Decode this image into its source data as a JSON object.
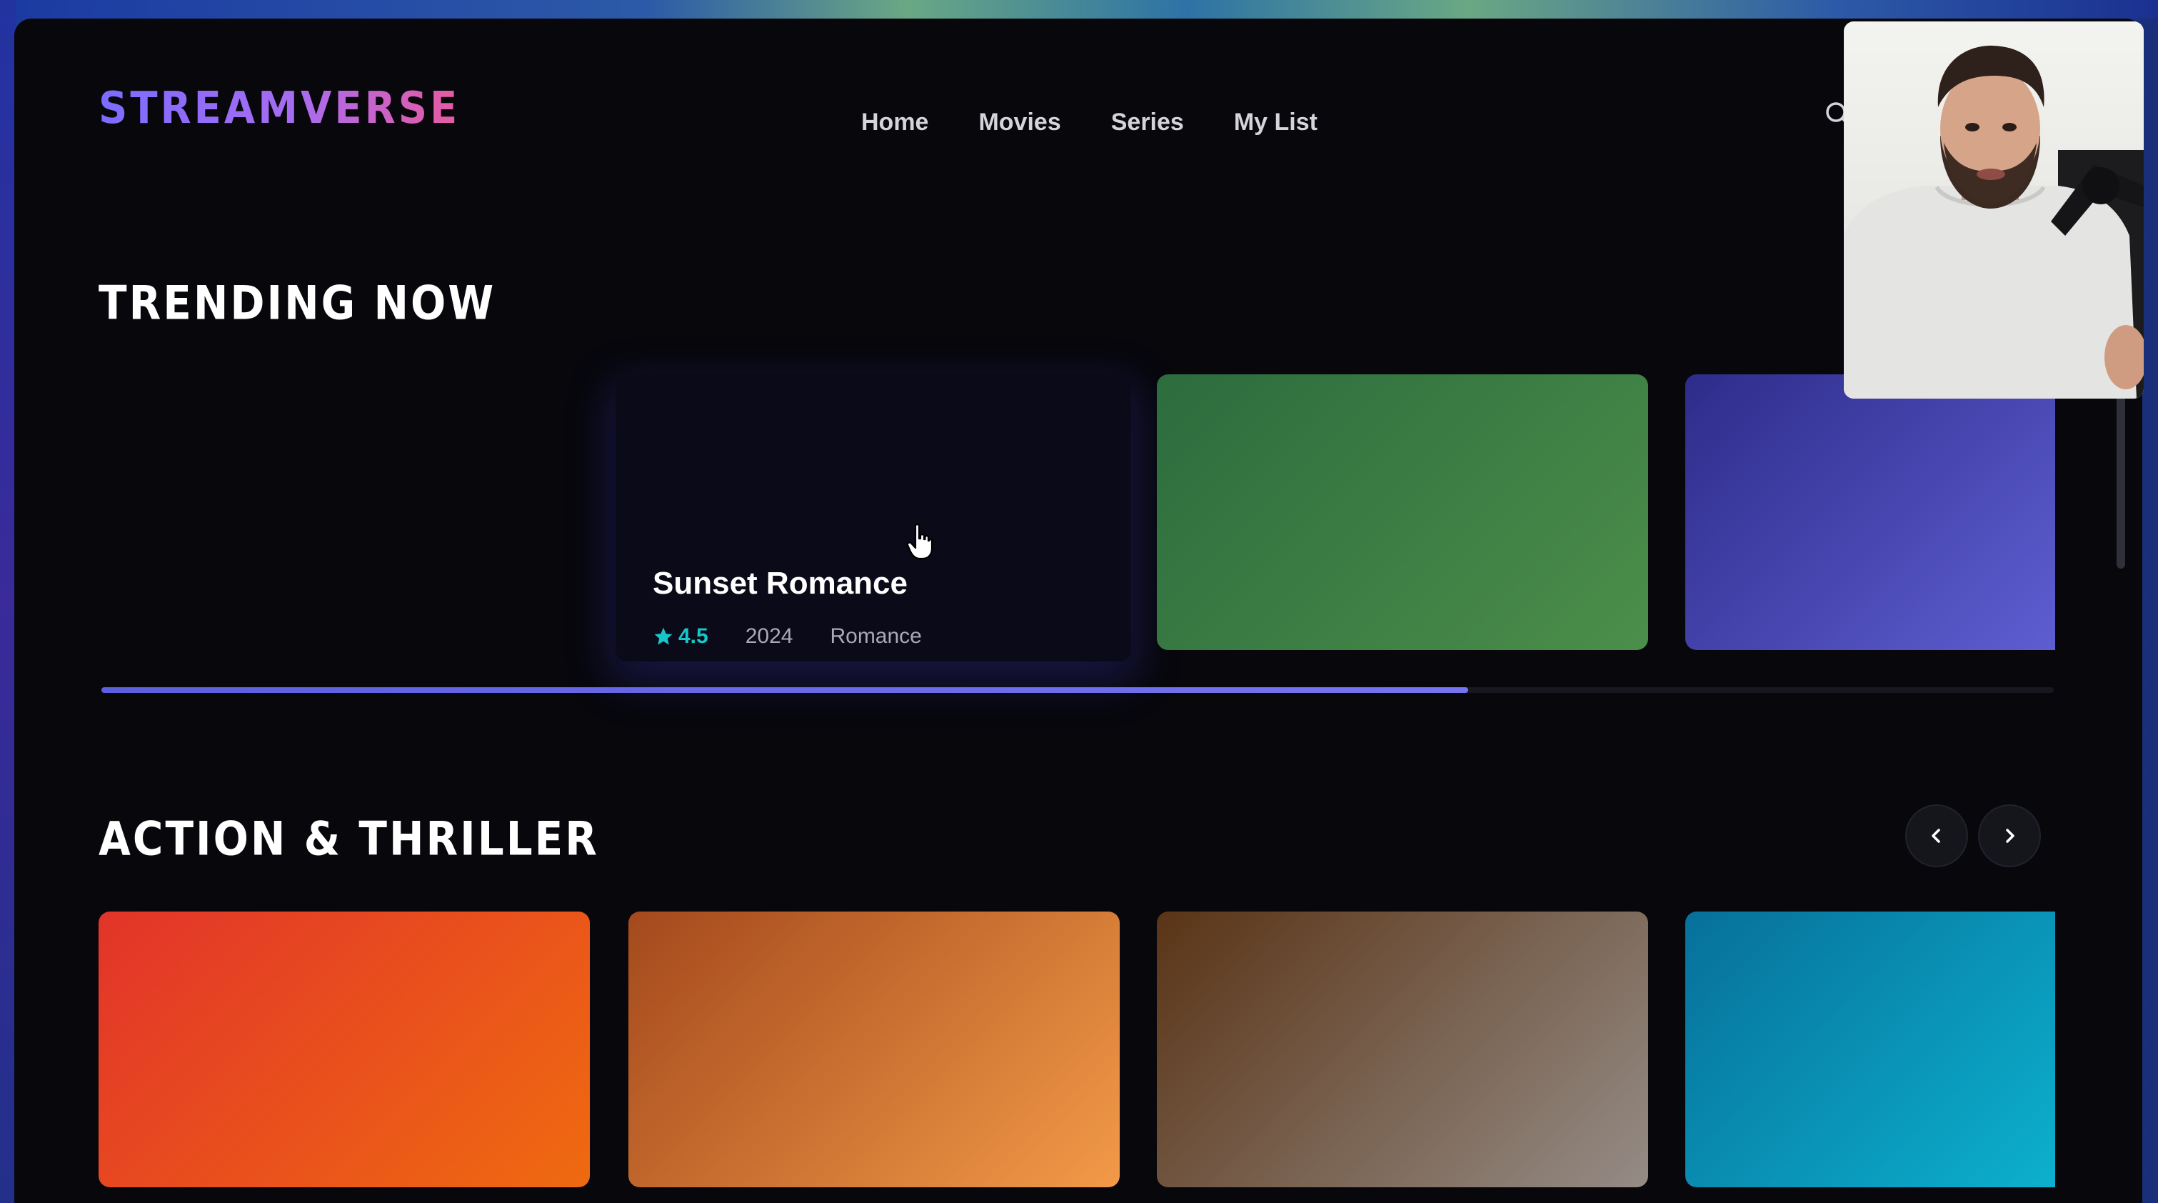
{
  "app": {
    "logo": "STREAMVERSE"
  },
  "nav": {
    "items": [
      {
        "label": "Home"
      },
      {
        "label": "Movies"
      },
      {
        "label": "Series"
      },
      {
        "label": "My List"
      }
    ],
    "search_icon": "search-icon"
  },
  "trending": {
    "title": "TRENDING NOW",
    "featured": {
      "title": "Sunset Romance",
      "rating": "4.5",
      "year": "2024",
      "genre": "Romance"
    },
    "progress_percent": 70,
    "cards": [
      {
        "colors": [
          "#2c6c3e",
          "#4c8e4a"
        ]
      },
      {
        "colors": [
          "#2e2c8a",
          "#5e5ed2"
        ]
      }
    ]
  },
  "action": {
    "title": "ACTION & THRILLER",
    "prev_icon": "chevron-left-icon",
    "next_icon": "chevron-right-icon",
    "cards": [
      {
        "colors": [
          "#e2342a",
          "#ef6a10"
        ]
      },
      {
        "colors": [
          "#a4491c",
          "#f29a48"
        ]
      },
      {
        "colors": [
          "#5a3416",
          "#958c86"
        ]
      },
      {
        "colors": [
          "#07709a",
          "#0cb0ce"
        ]
      }
    ]
  },
  "theme": {
    "background": "#07070c",
    "accent": "#6d6cf0",
    "rating_color": "#17c7c7"
  }
}
